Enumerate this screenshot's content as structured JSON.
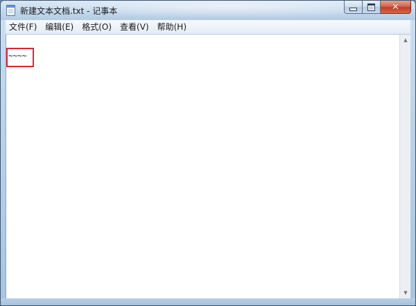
{
  "window": {
    "title": "新建文本文档.txt - 记事本",
    "close_glyph": "✕"
  },
  "menu": {
    "items": [
      {
        "label": "文件(F)"
      },
      {
        "label": "编辑(E)"
      },
      {
        "label": "格式(O)"
      },
      {
        "label": "查看(V)"
      },
      {
        "label": "帮助(H)"
      }
    ]
  },
  "editor": {
    "content": "~~~~"
  },
  "scrollbar": {
    "up_glyph": "▲",
    "down_glyph": "▼"
  },
  "colors": {
    "highlight": "#d9262e",
    "close_button": "#c03e22",
    "frame": "#bcd2e8"
  }
}
